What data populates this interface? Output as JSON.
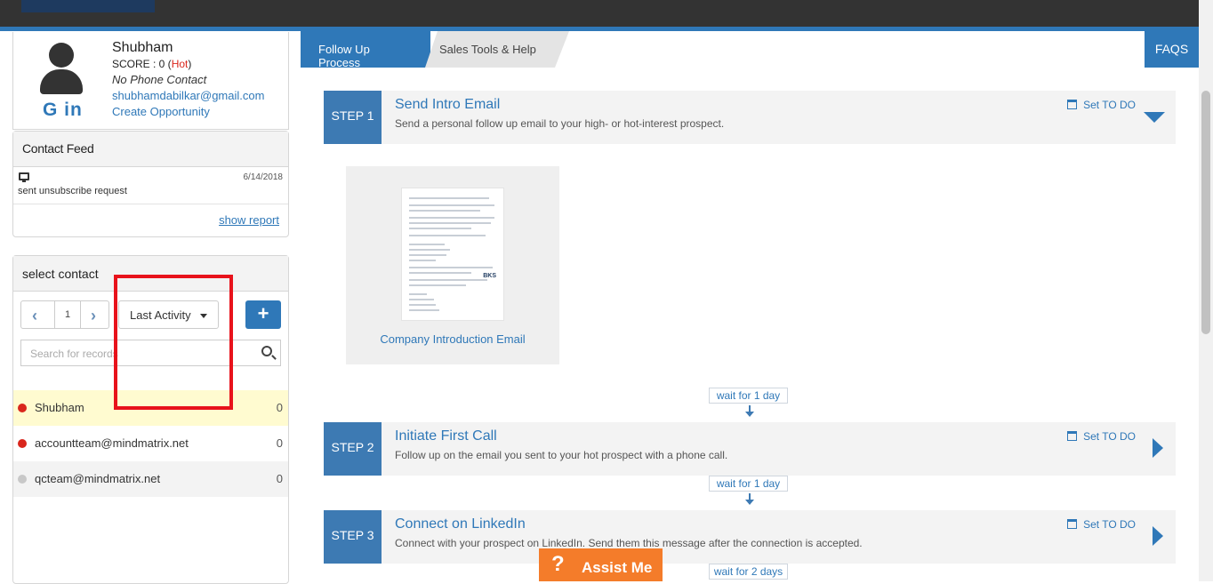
{
  "profile": {
    "name": "Shubham",
    "score_label": "SCORE : 0 (",
    "score_status": "Hot",
    "score_close": ")",
    "phone": "No Phone Contact",
    "email": "shubhamdabilkar@gmail.com",
    "create_opportunity": "Create Opportunity",
    "social_icons": "G in"
  },
  "contact_feed": {
    "title": "Contact Feed",
    "item": {
      "icon": "monitor-icon",
      "date": "6/14/2018",
      "text": "sent unsubscribe request"
    },
    "show_report": "show report"
  },
  "select_contact": {
    "title": "select contact",
    "page": "1",
    "sort_label": "Last Activity",
    "add_label": "+",
    "search_placeholder": "Search for records",
    "contacts": [
      {
        "name": "Shubham",
        "count": "0",
        "status_color": "#d9261c",
        "highlighted": true
      },
      {
        "name": "accountteam@mindmatrix.net",
        "count": "0",
        "status_color": "#d9261c",
        "highlighted": false
      },
      {
        "name": "qcteam@mindmatrix.net",
        "count": "0",
        "status_color": "#c8c8c8",
        "highlighted": false
      }
    ]
  },
  "tabs": {
    "follow_up": "Follow Up Process",
    "sales_tools": "Sales Tools & Help",
    "faqs": "FAQS"
  },
  "steps": [
    {
      "badge": "STEP 1",
      "title": "Send Intro Email",
      "desc": "Send a personal follow up email to your high- or hot-interest prospect.",
      "todo": "Set TO DO",
      "expanded": true
    },
    {
      "badge": "STEP 2",
      "title": "Initiate First Call",
      "desc": "Follow up on the email you sent to your hot prospect with a phone call.",
      "todo": "Set TO DO",
      "expanded": false
    },
    {
      "badge": "STEP 3",
      "title": "Connect on LinkedIn",
      "desc": "Connect with your prospect on LinkedIn. Send them this message after the connection is accepted.",
      "todo": "Set TO DO",
      "expanded": false
    }
  ],
  "template_card": {
    "caption": "Company Introduction Email",
    "logo_text": "BKS"
  },
  "waits": [
    "wait for 1 day",
    "wait for 1 day",
    "wait for 2 days"
  ],
  "assist": {
    "icon": "?",
    "label": "Assist Me"
  },
  "colors": {
    "accent": "#2f78b8",
    "hot": "#d9261c",
    "assist": "#f47c2a",
    "highlight_box": "#e8121b"
  }
}
